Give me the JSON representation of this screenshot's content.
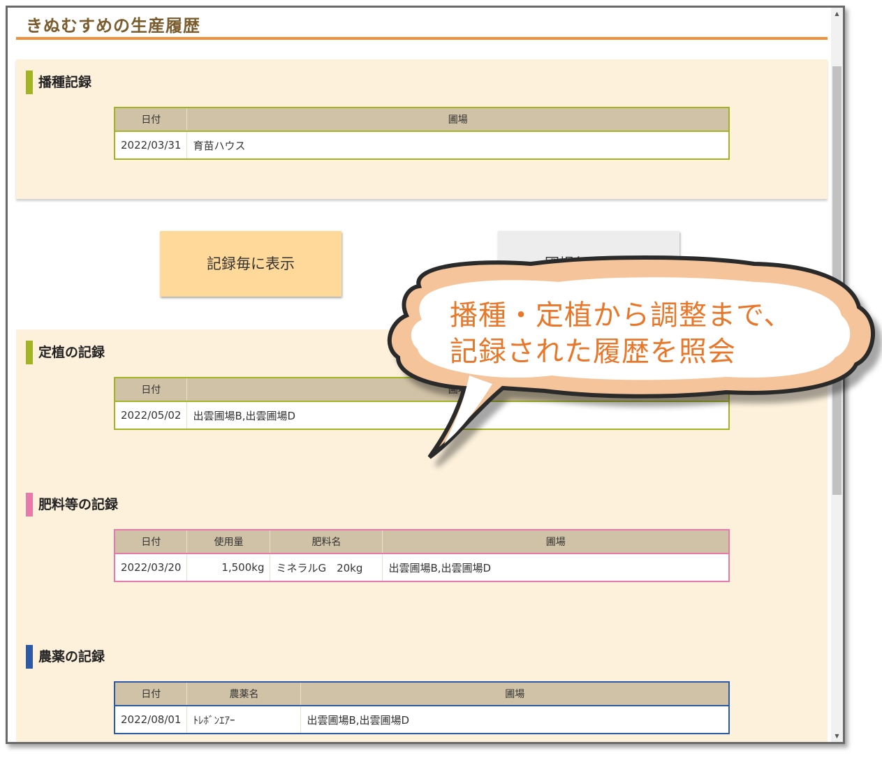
{
  "page": {
    "title": "きぬむすめの生産履歴"
  },
  "sowing": {
    "heading": "播種記録",
    "columns": [
      "日付",
      "圃場"
    ],
    "rows": [
      {
        "date": "2022/03/31",
        "field": "育苗ハウス"
      }
    ]
  },
  "buttons": {
    "by_record": "記録毎に表示",
    "by_field": "圃場毎に表示"
  },
  "planting": {
    "heading": "定植の記録",
    "columns": [
      "日付",
      "圃場"
    ],
    "rows": [
      {
        "date": "2022/05/02",
        "field": "出雲圃場B,出雲圃場D"
      }
    ]
  },
  "fertilizer": {
    "heading": "肥料等の記録",
    "columns": [
      "日付",
      "使用量",
      "肥料名",
      "圃場"
    ],
    "rows": [
      {
        "date": "2022/03/20",
        "amount": "1,500kg",
        "name": "ミネラルG　20kg",
        "field": "出雲圃場B,出雲圃場D"
      }
    ]
  },
  "pesticide": {
    "heading": "農薬の記録",
    "columns": [
      "日付",
      "農薬名",
      "圃場"
    ],
    "rows": [
      {
        "date": "2022/08/01",
        "name": "ﾄﾚﾎﾞﾝｴｱｰ",
        "field": "出雲圃場B,出雲圃場D"
      }
    ]
  },
  "callout": {
    "line1": "播種・定植から調整まで、",
    "line2": "記録された履歴を照会"
  },
  "colors": {
    "accent_orange": "#f0913a",
    "callout_text": "#e8772a",
    "green": "#a2b324",
    "pink": "#e77aaa",
    "blue": "#2b59a6"
  }
}
